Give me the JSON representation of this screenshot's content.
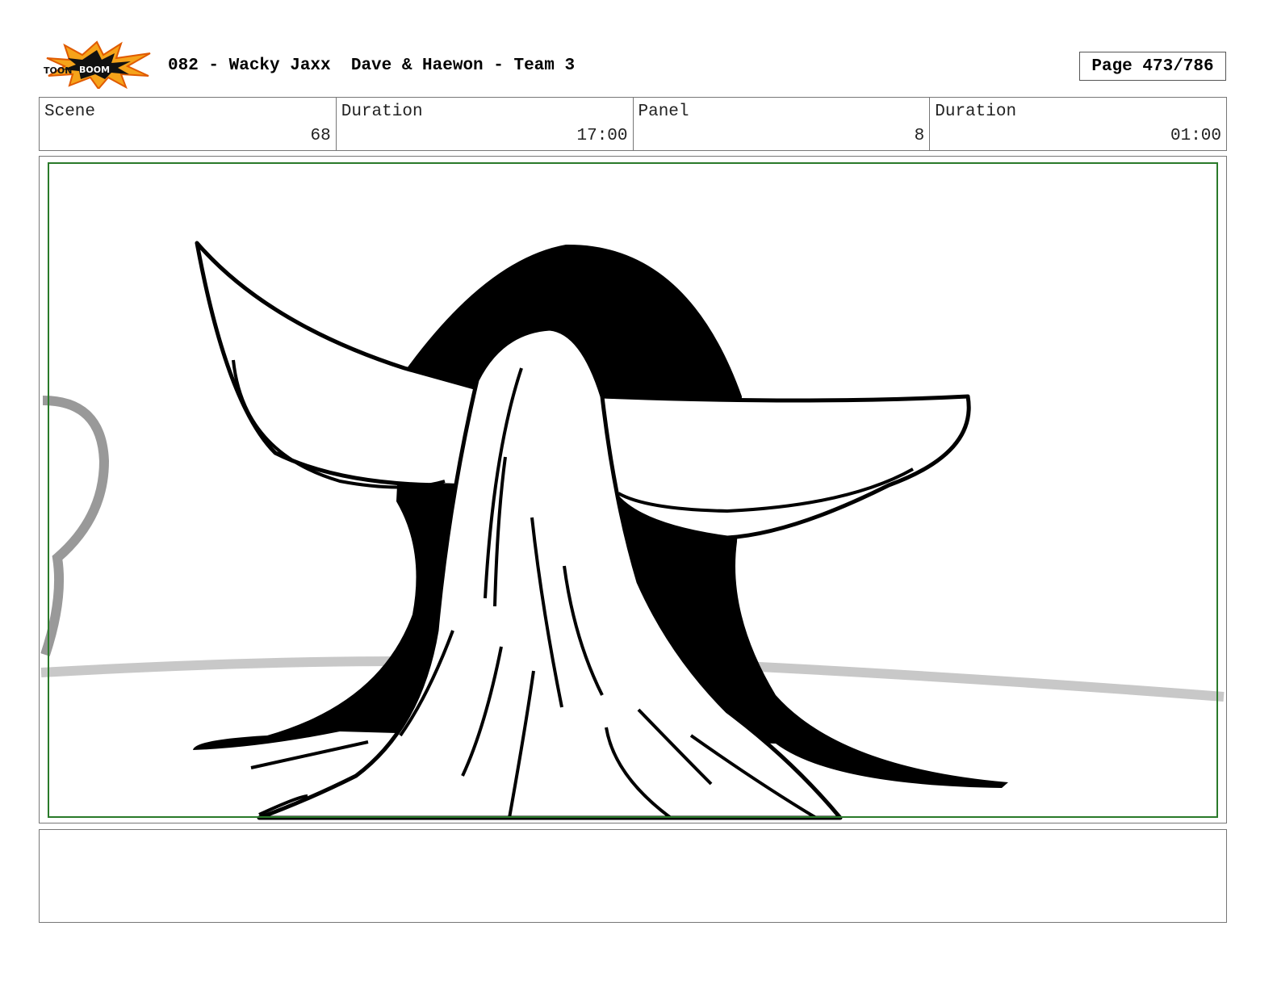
{
  "header": {
    "logo_text": "TOONBOOM",
    "title": "082 - Wacky Jaxx  Dave & Haewon - Team 3",
    "page": "Page 473/786"
  },
  "info": {
    "scene_label": "Scene",
    "scene_value": "68",
    "scene_duration_label": "Duration",
    "scene_duration_value": "17:00",
    "panel_label": "Panel",
    "panel_value": "8",
    "panel_duration_label": "Duration",
    "panel_duration_value": "01:00"
  },
  "caption": {}
}
